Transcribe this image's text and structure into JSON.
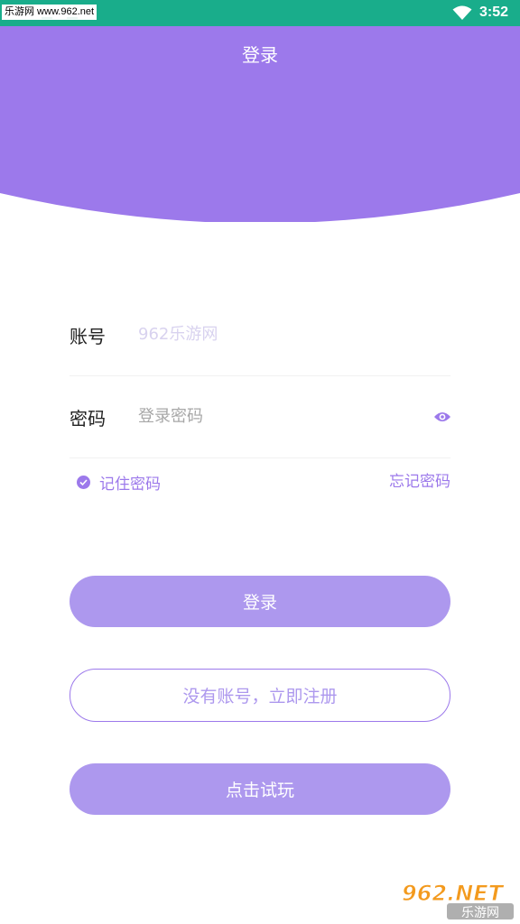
{
  "status_bar": {
    "watermark": "乐游网 www.962.net",
    "time": "3:52",
    "wifi_icon": "wifi-icon"
  },
  "header": {
    "title": "登录"
  },
  "form": {
    "account_label": "账号",
    "account_placeholder": "962乐游网",
    "password_label": "密码",
    "password_placeholder": "登录密码",
    "password_toggle_icon": "eye-icon",
    "remember_label": "记住密码",
    "remember_checked": true,
    "forgot_label": "忘记密码"
  },
  "buttons": {
    "login": "登录",
    "register": "没有账号，立即注册",
    "trial": "点击试玩"
  },
  "watermark_logo": {
    "text_top": "962.NET",
    "text_bottom": "乐游网"
  },
  "colors": {
    "status_bar": "#19ad8b",
    "accent": "#9c79eb",
    "button_fill": "#ad98ee"
  }
}
